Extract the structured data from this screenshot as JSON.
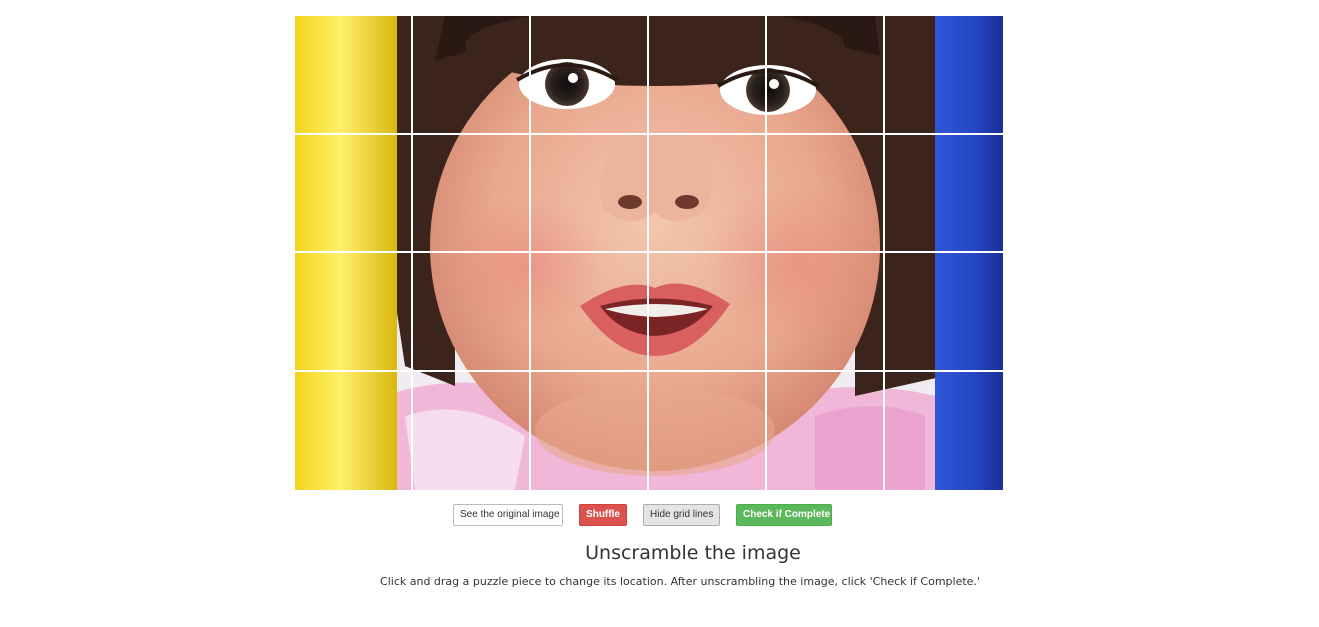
{
  "puzzle": {
    "image_alt": "Close-up photo of a young child's face between a yellow pole and a blue pole",
    "rows": 4,
    "columns": 6,
    "grid_lines_visible": true,
    "grid_line_color": "#ffffff"
  },
  "controls": {
    "see_original_label": "See the original image",
    "shuffle_label": "Shuffle",
    "hide_grid_label": "Hide grid lines",
    "check_complete_label": "Check if Complete",
    "colors": {
      "shuffle": "#d9534f",
      "check_complete": "#5cb85c",
      "hide_grid": "#e4e4e4"
    }
  },
  "content": {
    "heading": "Unscramble the image",
    "instructions": "Click and drag a puzzle piece to change its location. After unscrambling the image, click 'Check if Complete.'"
  }
}
